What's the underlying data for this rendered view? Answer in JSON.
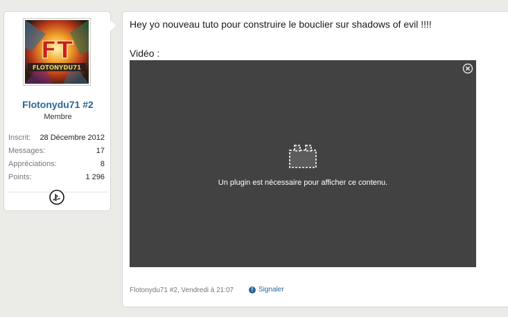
{
  "user": {
    "avatar_text": "FLOTONYDU71",
    "name": "Flotonydu71 #2",
    "title": "Membre",
    "stats": [
      {
        "label": "Inscrit:",
        "value": "28 Décembre 2012"
      },
      {
        "label": "Messages:",
        "value": "17"
      },
      {
        "label": "Appréciations:",
        "value": "8"
      },
      {
        "label": "Points:",
        "value": "1 296"
      }
    ],
    "badge_icon": "playstation-icon"
  },
  "post": {
    "text": "Hey yo nouveau tuto pour construire le bouclier sur shadows of evil !!!!",
    "video_label": "Vidéo :",
    "plugin_message": "Un plugin est nécessaire pour afficher ce contenu.",
    "meta": "Flotonydu71 #2, Vendredi à 21:07",
    "report_label": "Signaler",
    "report_icon": "info-icon",
    "close_icon": "close-icon"
  }
}
